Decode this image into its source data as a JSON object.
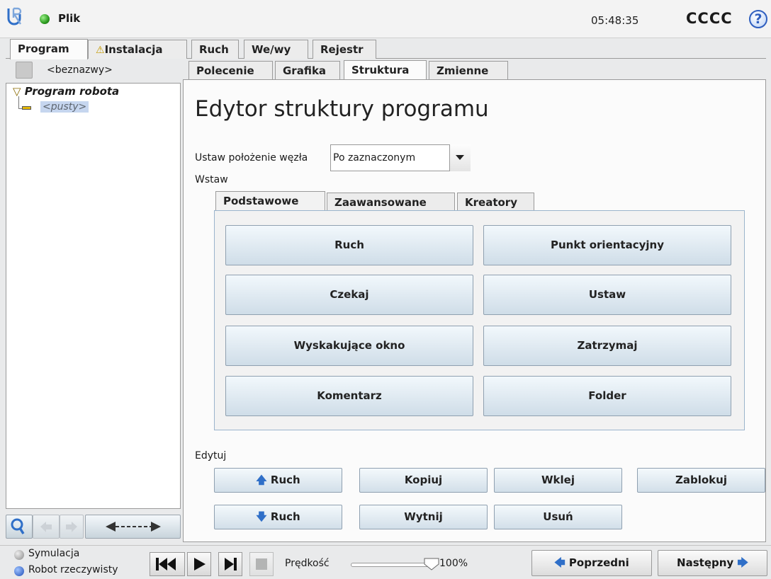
{
  "header": {
    "app_title": "Plik",
    "clock": "05:48:35",
    "robot_name": "CCCC",
    "help_label": "?"
  },
  "main_tabs": [
    {
      "label": "Program",
      "active": true
    },
    {
      "label": "Instalacja",
      "warning": true
    },
    {
      "label": "Ruch"
    },
    {
      "label": "We/wy"
    },
    {
      "label": "Rejestr"
    }
  ],
  "program": {
    "name": "<beznazwy>",
    "tree_root": "Program robota",
    "tree_child": "<pusty>"
  },
  "sub_tabs": [
    {
      "label": "Polecenie"
    },
    {
      "label": "Grafika"
    },
    {
      "label": "Struktura",
      "active": true
    },
    {
      "label": "Zmienne"
    }
  ],
  "editor": {
    "title": "Edytor struktury programu",
    "node_position_label": "Ustaw położenie węzła",
    "node_position_value": "Po zaznaczonym",
    "insert_label": "Wstaw",
    "insert_tabs": [
      {
        "label": "Podstawowe",
        "active": true
      },
      {
        "label": "Zaawansowane"
      },
      {
        "label": "Kreatory"
      }
    ],
    "insert_buttons": [
      "Ruch",
      "Punkt orientacyjny",
      "Czekaj",
      "Ustaw",
      "Wyskakujące okno",
      "Zatrzymaj",
      "Komentarz",
      "Folder"
    ],
    "edit_label": "Edytuj",
    "edit_buttons": {
      "move_up": "Ruch",
      "copy": "Kopiuj",
      "paste": "Wklej",
      "lock": "Zablokuj",
      "move_down": "Ruch",
      "cut": "Wytnij",
      "delete": "Usuń"
    }
  },
  "footer": {
    "simulation_label": "Symulacja",
    "real_robot_label": "Robot rzeczywisty",
    "speed_label": "Prędkość",
    "speed_value": "100%",
    "speed_fraction": 1.0,
    "prev_label": "Poprzedni",
    "next_label": "Następny"
  },
  "colors": {
    "accent_blue": "#2f5fbf",
    "status_green": "#2b9b1f",
    "warning_yellow": "#e6b800"
  }
}
